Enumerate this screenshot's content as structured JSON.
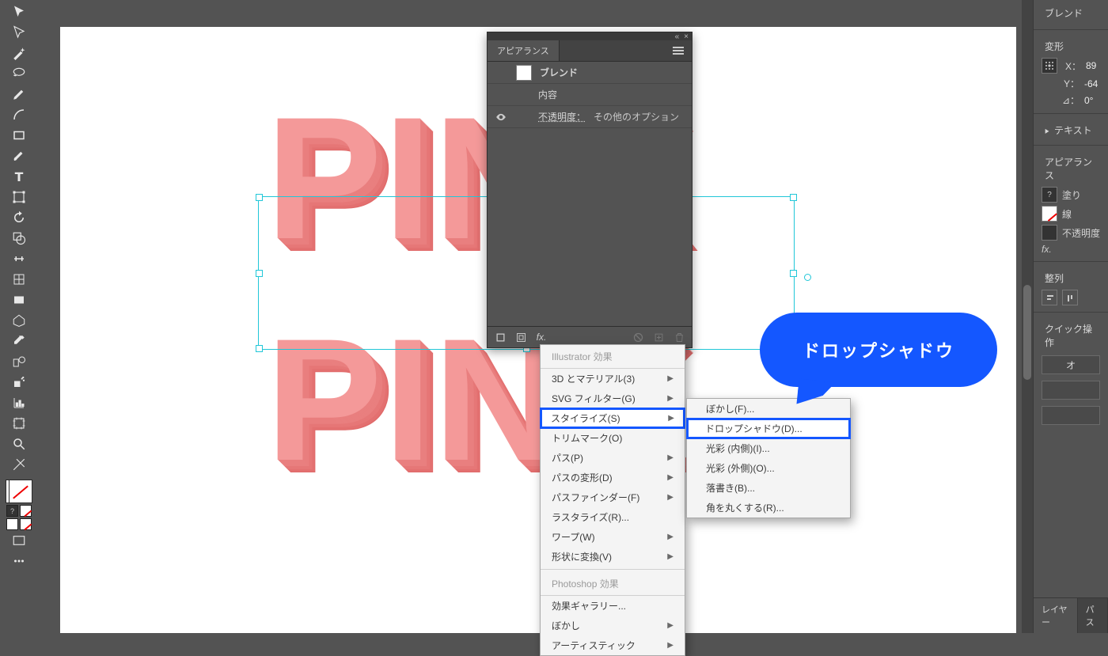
{
  "canvas": {
    "text1": "PINK",
    "text2": "PINK"
  },
  "appearance": {
    "tab": "アピアランス",
    "row_blend": "ブレンド",
    "row_content": "内容",
    "row_opacity_label": "不透明度：",
    "row_opacity_value": "その他のオプション"
  },
  "fx_menu": {
    "header1": "Illustrator 効果",
    "items1": [
      {
        "label": "3D とマテリアル(3)",
        "arrow": true
      },
      {
        "label": "SVG フィルター(G)",
        "arrow": true
      },
      {
        "label": "スタイライズ(S)",
        "arrow": true,
        "hl": true
      },
      {
        "label": "トリムマーク(O)"
      },
      {
        "label": "パス(P)",
        "arrow": true
      },
      {
        "label": "パスの変形(D)",
        "arrow": true
      },
      {
        "label": "パスファインダー(F)",
        "arrow": true
      },
      {
        "label": "ラスタライズ(R)..."
      },
      {
        "label": "ワープ(W)",
        "arrow": true
      },
      {
        "label": "形状に変換(V)",
        "arrow": true
      }
    ],
    "header2": "Photoshop 効果",
    "items2": [
      {
        "label": "効果ギャラリー..."
      },
      {
        "label": "ぼかし",
        "arrow": true
      },
      {
        "label": "アーティスティック",
        "arrow": true
      }
    ]
  },
  "sub_menu": {
    "items": [
      {
        "label": "ぼかし(F)..."
      },
      {
        "label": "ドロップシャドウ(D)...",
        "hl": true
      },
      {
        "label": "光彩 (内側)(I)..."
      },
      {
        "label": "光彩 (外側)(O)..."
      },
      {
        "label": "落書き(B)..."
      },
      {
        "label": "角を丸くする(R)..."
      }
    ]
  },
  "callout": "ドロップシャドウ",
  "right": {
    "title": "ブレンド",
    "transform": "変形",
    "x_label": "X：",
    "x_val": "89",
    "y_label": "Y：",
    "y_val": "-64",
    "angle_label": "⊿：",
    "angle_val": "0°",
    "text_more": "テキスト",
    "appearance_title": "アピアランス",
    "fill": "塗り",
    "stroke": "線",
    "opacity": "不透明度",
    "fx": "fx.",
    "align": "整列",
    "quick": "クイック操作",
    "btn1": "オ",
    "tab_layer": "レイヤー",
    "tab_other": "パス"
  }
}
